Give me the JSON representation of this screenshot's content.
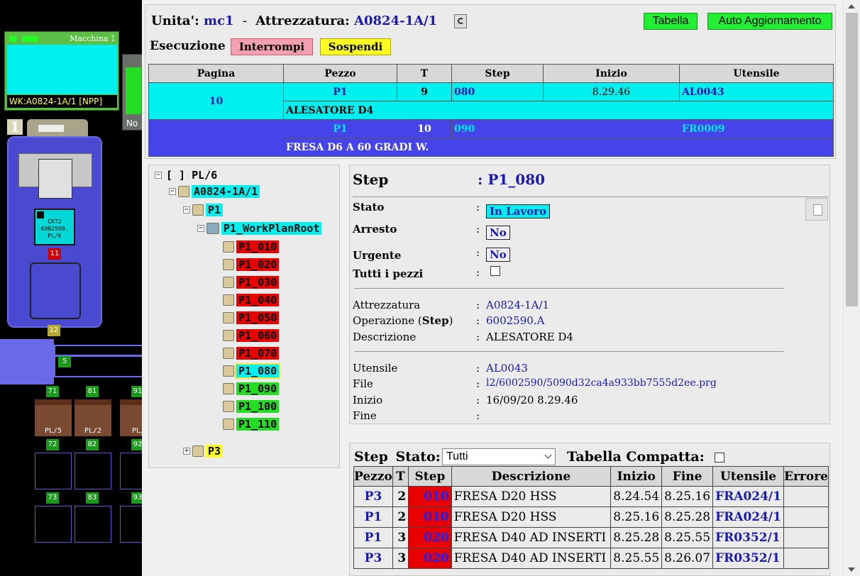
{
  "machine": {
    "name": "Macchina 1",
    "wk": "WK:A0824-1A/1 [NPP]",
    "side_label": "No",
    "number": "1",
    "pallet_lines": [
      "CRT2",
      "6002590.",
      "PL/6"
    ],
    "badge_red": "11",
    "badge_olive": "12",
    "badge_rail": "5",
    "slots_row1": [
      {
        "n": "71",
        "lbl": "PL/5"
      },
      {
        "n": "81",
        "lbl": "PL/2"
      },
      {
        "n": "91",
        "lbl": "PL/"
      }
    ],
    "slots_row2": [
      "72",
      "82",
      "92"
    ],
    "slots_row3": [
      "73",
      "83",
      "93"
    ]
  },
  "header": {
    "unit_label": "Unita':",
    "unit": "mc1",
    "sep": "-",
    "att_label": "Attrezzatura:",
    "att": "A0824-1A/1",
    "btn_table": "Tabella",
    "btn_auto": "Auto Aggiornamento",
    "exec_label": "Esecuzione",
    "btn_interrupt": "Interrompi",
    "btn_suspend": "Sospendi"
  },
  "top_table": {
    "headers": [
      "Pagina",
      "Pezzo",
      "T",
      "Step",
      "Inizio",
      "Utensile"
    ],
    "page": "10",
    "rows": [
      {
        "pezzo": "P1",
        "t": "9",
        "step": "080",
        "inizio": "8.29.46",
        "utensile": "AL0043",
        "desc": "ALESATORE D4"
      },
      {
        "pezzo": "P1",
        "t": "10",
        "step": "090",
        "inizio": "",
        "utensile": "FR0009",
        "desc": "FRESA D6 A 60 GRADI W."
      }
    ]
  },
  "tree": {
    "root": "[ ] PL/6",
    "fixture": "A0824-1A/1",
    "part1": "P1",
    "workplan": "P1_WorkPlanRoot",
    "steps": [
      "P1_010",
      "P1_020",
      "P1_030",
      "P1_040",
      "P1_050",
      "P1_060",
      "P1_070",
      "P1_080",
      "P1_090",
      "P1_100",
      "P1_110"
    ],
    "part3": "P3"
  },
  "detail": {
    "title": "Step",
    "value": ": P1_080",
    "labels": {
      "stato": "Stato",
      "arresto": "Arresto",
      "urgente": "Urgente",
      "tutti": "Tutti i pezzi",
      "attrezzatura": "Attrezzatura",
      "operazione": "Operazione (",
      "operazione_b": "Step",
      "operazione_end": ")",
      "descrizione": "Descrizione",
      "utensile": "Utensile",
      "file": "File",
      "inizio": "Inizio",
      "fine": "Fine"
    },
    "values": {
      "stato": "In Lavoro",
      "arresto": "No",
      "urgente": "No",
      "attrezzatura": "A0824-1A/1",
      "operazione": "6002590.A",
      "descrizione": "ALESATORE D4",
      "utensile": "AL0043",
      "file": "l2/6002590/5090d32ca4a933bb7555d2ee.prg",
      "inizio": "16/09/20 8.29.46",
      "fine": ""
    }
  },
  "steps_list": {
    "label_step": "Step",
    "label_stato": "Stato:",
    "filter": "Tutti",
    "compact_label": "Tabella Compatta:",
    "headers": [
      "Pezzo",
      "T",
      "Step",
      "Descrizione",
      "Inizio",
      "Fine",
      "Utensile",
      "Errore"
    ],
    "rows": [
      {
        "pezzo": "P3",
        "t": "2",
        "step": "010",
        "desc": "FRESA D20 HSS",
        "inizio": "8.24.54",
        "fine": "8.25.16",
        "ut": "FRA024/1",
        "err": ""
      },
      {
        "pezzo": "P1",
        "t": "2",
        "step": "010",
        "desc": "FRESA D20 HSS",
        "inizio": "8.25.16",
        "fine": "8.25.28",
        "ut": "FRA024/1",
        "err": ""
      },
      {
        "pezzo": "P1",
        "t": "3",
        "step": "020",
        "desc": "FRESA D40 AD INSERTI",
        "inizio": "8.25.28",
        "fine": "8.25.55",
        "ut": "FR0352/1",
        "err": ""
      },
      {
        "pezzo": "P3",
        "t": "3",
        "step": "020",
        "desc": "FRESA D40 AD INSERTI",
        "inizio": "8.25.55",
        "fine": "8.26.07",
        "ut": "FR0352/1",
        "err": ""
      }
    ]
  }
}
